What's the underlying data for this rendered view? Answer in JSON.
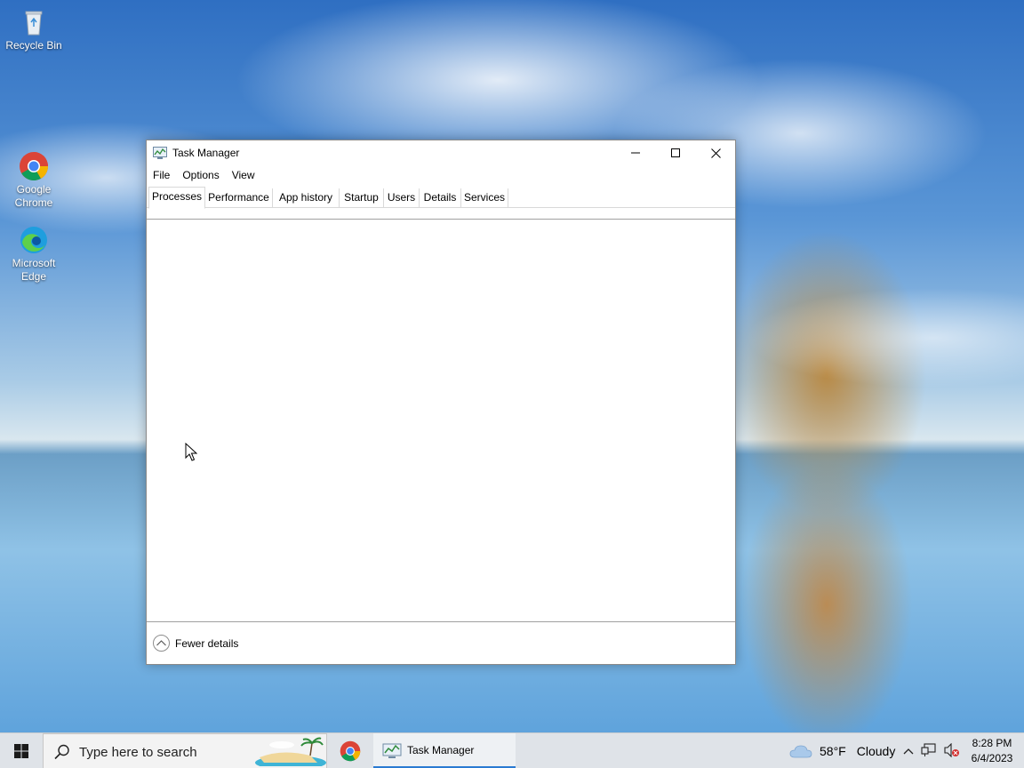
{
  "desktop": {
    "icons": [
      {
        "label": "Recycle Bin"
      },
      {
        "label": "Google Chrome"
      },
      {
        "label": "Microsoft Edge"
      }
    ]
  },
  "window": {
    "title": "Task Manager",
    "menu": [
      "File",
      "Options",
      "View"
    ],
    "tabs": [
      "Processes",
      "Performance",
      "App history",
      "Startup",
      "Users",
      "Details",
      "Services"
    ],
    "active_tab": "Processes",
    "footer_label": "Fewer details"
  },
  "taskbar": {
    "search_placeholder": "Type here to search",
    "task_label": "Task Manager",
    "weather_temp": "58°F",
    "weather_condition": "Cloudy",
    "time": "8:28 PM",
    "date": "6/4/2023"
  },
  "colors": {
    "accent": "#2a7ad2",
    "taskbar_bg": "#dfe3e8",
    "window_border": "#8a8a8a"
  }
}
